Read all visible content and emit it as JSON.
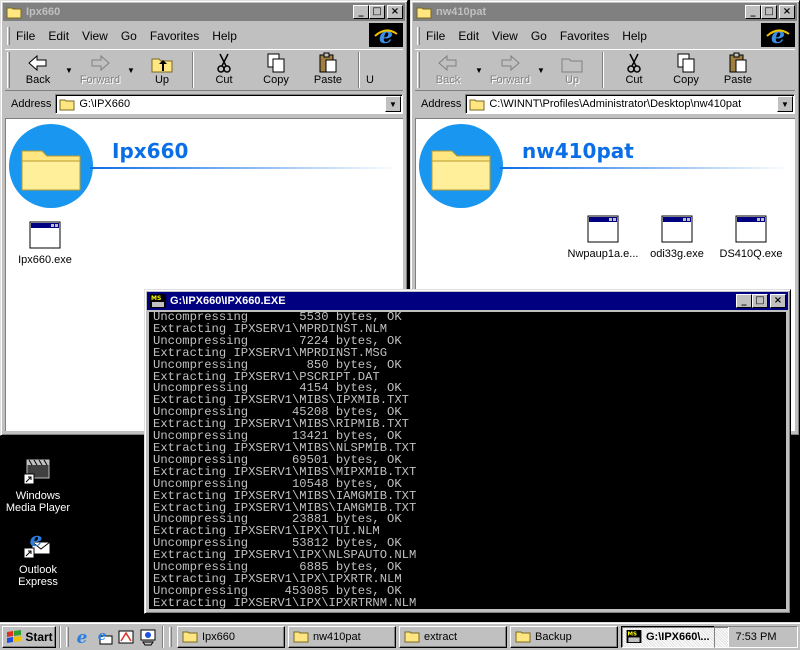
{
  "windows": {
    "left": {
      "title": "Ipx660",
      "menu": [
        "File",
        "Edit",
        "View",
        "Go",
        "Favorites",
        "Help"
      ],
      "toolbar": [
        "Back",
        "Forward",
        "Up",
        "Cut",
        "Copy",
        "Paste",
        "U"
      ],
      "address_label": "Address",
      "address": "G:\\IPX660",
      "folder_title": "Ipx660",
      "files": [
        "Ipx660.exe"
      ]
    },
    "right": {
      "title": "nw410pat",
      "menu": [
        "File",
        "Edit",
        "View",
        "Go",
        "Favorites",
        "Help"
      ],
      "toolbar": [
        "Back",
        "Forward",
        "Up",
        "Cut",
        "Copy",
        "Paste"
      ],
      "address_label": "Address",
      "address": "C:\\WINNT\\Profiles\\Administrator\\Desktop\\nw410pat",
      "folder_title": "nw410pat",
      "files": [
        "Nwpaup1a.e...",
        "odi33g.exe",
        "DS410Q.exe"
      ]
    },
    "console": {
      "title": "G:\\IPX660\\IPX660.EXE",
      "lines": [
        "Uncompressing       5530 bytes, OK",
        "Extracting IPXSERV1\\MPRDINST.NLM",
        "Uncompressing       7224 bytes, OK",
        "Extracting IPXSERV1\\MPRDINST.MSG",
        "Uncompressing        850 bytes, OK",
        "Extracting IPXSERV1\\PSCRIPT.DAT",
        "Uncompressing       4154 bytes, OK",
        "Extracting IPXSERV1\\MIBS\\IPXMIB.TXT",
        "Uncompressing      45208 bytes, OK",
        "Extracting IPXSERV1\\MIBS\\RIPMIB.TXT",
        "Uncompressing      13421 bytes, OK",
        "Extracting IPXSERV1\\MIBS\\NLSPMIB.TXT",
        "Uncompressing      69501 bytes, OK",
        "Extracting IPXSERV1\\MIBS\\MIPXMIB.TXT",
        "Uncompressing      10548 bytes, OK",
        "Extracting IPXSERV1\\MIBS\\IAMGMIB.TXT",
        "Extracting IPXSERV1\\MIBS\\IAMGMIB.TXT",
        "Uncompressing      23881 bytes, OK",
        "Extracting IPXSERV1\\IPX\\TUI.NLM",
        "Uncompressing      53812 bytes, OK",
        "Extracting IPXSERV1\\IPX\\NLSPAUTO.NLM",
        "Uncompressing       6885 bytes, OK",
        "Extracting IPXSERV1\\IPX\\IPXRTR.NLM",
        "Uncompressing     453085 bytes, OK",
        "Extracting IPXSERV1\\IPX\\IPXRTRNM.NLM"
      ]
    }
  },
  "desktop_icons": [
    {
      "label": "Windows\nMedia Player",
      "icon": "media-player-icon"
    },
    {
      "label": "Outlook\nExpress",
      "icon": "outlook-express-icon"
    }
  ],
  "taskbar": {
    "start_label": "Start",
    "quick_launch": [
      "ie-icon",
      "outlook-icon",
      "channels-icon",
      "show-desktop-icon"
    ],
    "tasks": [
      {
        "label": "Ipx660",
        "active": false
      },
      {
        "label": "nw410pat",
        "active": false
      },
      {
        "label": "extract",
        "active": false
      },
      {
        "label": "Backup",
        "active": false
      },
      {
        "label": "G:\\IPX660\\...",
        "active": true
      }
    ],
    "clock": "7:53 PM"
  },
  "colors": {
    "active_title": "#000080",
    "inactive_title": "#808080",
    "folder_title": "#0a6ee6",
    "face": "#c0c0c0"
  }
}
